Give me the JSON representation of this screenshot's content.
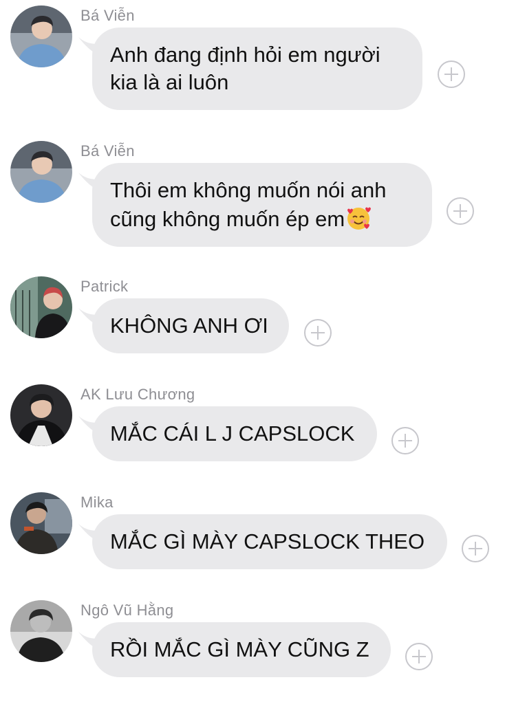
{
  "messages": [
    {
      "sender": "Bá Viễn",
      "lines": [
        "Anh đang định hỏi em người",
        "kia là ai luôn"
      ],
      "reaction_icon": "add-reaction-icon"
    },
    {
      "sender": "Bá Viễn",
      "lines": [
        "Thôi em không muốn nói anh",
        "cũng không muốn ép em"
      ],
      "emoji": "smiling-face-with-hearts-emoji",
      "reaction_icon": "add-reaction-icon"
    },
    {
      "sender": "Patrick",
      "lines": [
        "KHÔNG ANH ƠI"
      ],
      "reaction_icon": "add-reaction-icon"
    },
    {
      "sender": "AK Lưu Chương",
      "lines": [
        "MẮC CÁI L J CAPSLOCK"
      ],
      "reaction_icon": "add-reaction-icon"
    },
    {
      "sender": "Mika",
      "lines": [
        "MẮC GÌ MÀY CAPSLOCK THEO"
      ],
      "reaction_icon": "add-reaction-icon"
    },
    {
      "sender": "Ngô Vũ Hằng",
      "lines": [
        "RỒI MẮC GÌ MÀY CŨNG Z"
      ],
      "reaction_icon": "add-reaction-icon"
    }
  ],
  "colors": {
    "bubble": "#e9e9eb",
    "sender": "#8e8e93",
    "text": "#111111",
    "reaction_outline": "#c7c7cc"
  }
}
